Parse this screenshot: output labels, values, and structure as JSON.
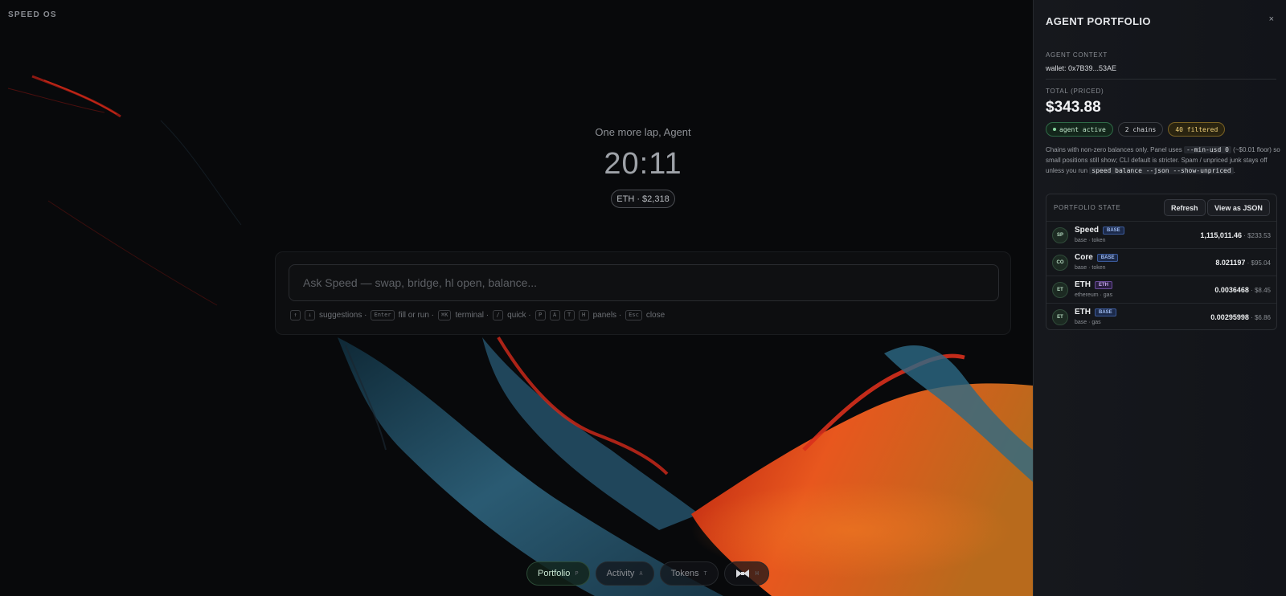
{
  "app": {
    "brand": "SPEED OS"
  },
  "hero": {
    "greeting": "One more lap, Agent",
    "clock": "20:11",
    "eth_price": "ETH · $2,318"
  },
  "prompt": {
    "placeholder": "Ask Speed — swap, bridge, hl open, balance...",
    "hints": [
      {
        "type": "kbd",
        "text": "↑"
      },
      {
        "type": "kbd",
        "text": "↓"
      },
      {
        "type": "text",
        "text": "suggestions ·"
      },
      {
        "type": "kbd",
        "text": "Enter"
      },
      {
        "type": "text",
        "text": "fill or run ·"
      },
      {
        "type": "kbd",
        "text": "⌘K"
      },
      {
        "type": "text",
        "text": "terminal ·"
      },
      {
        "type": "kbd",
        "text": "/"
      },
      {
        "type": "text",
        "text": "quick ·"
      },
      {
        "type": "kbd",
        "text": "P"
      },
      {
        "type": "kbd",
        "text": "A"
      },
      {
        "type": "kbd",
        "text": "T"
      },
      {
        "type": "kbd",
        "text": "H"
      },
      {
        "type": "text",
        "text": "panels ·"
      },
      {
        "type": "kbd",
        "text": "Esc"
      },
      {
        "type": "text",
        "text": "close"
      }
    ]
  },
  "dock": {
    "portfolio": {
      "label": "Portfolio",
      "shortcut": "P"
    },
    "activity": {
      "label": "Activity",
      "shortcut": "A"
    },
    "tokens": {
      "label": "Tokens",
      "shortcut": "T"
    },
    "hub": {
      "shortcut": "H"
    }
  },
  "panel": {
    "title": "AGENT PORTFOLIO",
    "close": "×",
    "context_label": "AGENT CONTEXT",
    "wallet": "wallet: 0x7B39...53AE",
    "total_label": "TOTAL (PRICED)",
    "total_value": "$343.88",
    "badges": {
      "active": "agent active",
      "chains": "2 chains",
      "filtered": "40 filtered"
    },
    "note": {
      "t1": "Chains with non-zero balances only. Panel uses ",
      "c1": "--min-usd 0",
      "t2": " (~$0.01 floor) so small positions still show; CLI default is stricter. Spam / unpriced junk stays off unless you run ",
      "c2": "speed balance --json --show-unpriced",
      "t3": "."
    },
    "state": {
      "label": "PORTFOLIO STATE",
      "refresh": "Refresh",
      "view_json": "View as JSON",
      "rows": [
        {
          "avatar": "SP",
          "name": "Speed",
          "chain": "BASE",
          "sub": "base · token",
          "amount": "1,115,011.46",
          "usd": " · $233.53"
        },
        {
          "avatar": "CO",
          "name": "Core",
          "chain": "BASE",
          "sub": "base · token",
          "amount": "8.021197",
          "usd": " · $95.04"
        },
        {
          "avatar": "ET",
          "name": "ETH",
          "chain": "ETH",
          "sub": "ethereum · gas",
          "amount": "0.0036468",
          "usd": " · $8.45"
        },
        {
          "avatar": "ET",
          "name": "ETH",
          "chain": "BASE",
          "sub": "base · gas",
          "amount": "0.00295998",
          "usd": " · $6.86"
        }
      ]
    }
  },
  "colors": {
    "accent_green": "#8bd9a3",
    "amber": "#f2d27a",
    "base_tag": "#9fbcf2",
    "eth_tag": "#c9a9f2",
    "wave_orange": "#e8571e",
    "wave_blue": "#2c5f78"
  }
}
